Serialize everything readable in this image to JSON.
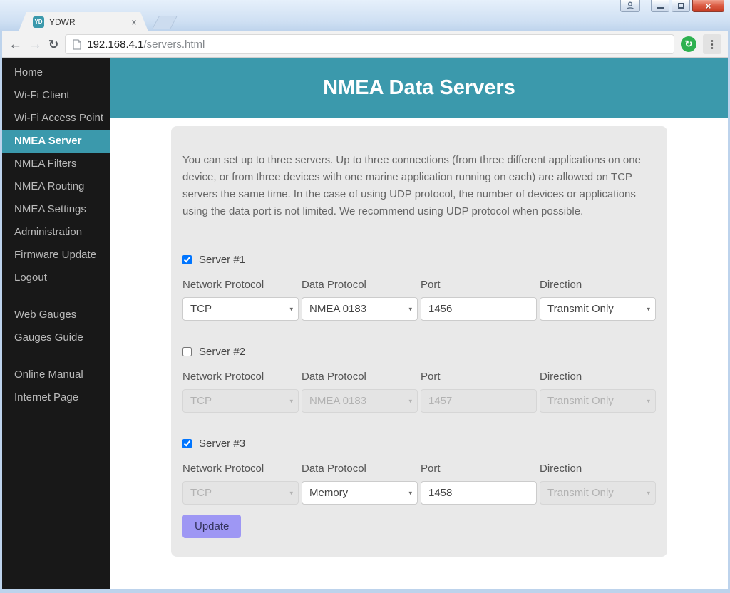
{
  "colors": {
    "teal": "#3b99ac",
    "sidebar_bg": "#181818",
    "accent_button": "#9e97f4",
    "green_badge": "#2eb150"
  },
  "icons": {
    "back": "←",
    "forward": "→",
    "reload": "↻",
    "menu": "⋮",
    "tab_close": "×",
    "window_close": "×",
    "select_arrow": "▾",
    "extension": "↻"
  },
  "browser": {
    "tab": {
      "favicon": "YD",
      "title": "YDWR"
    },
    "address": {
      "host": "192.168.4.1",
      "path": "/servers.html"
    }
  },
  "sidebar": {
    "groups": [
      {
        "items": [
          {
            "label": "Home"
          },
          {
            "label": "Wi-Fi Client"
          },
          {
            "label": "Wi-Fi Access Point"
          },
          {
            "label": "NMEA Server",
            "active": true
          },
          {
            "label": "NMEA Filters"
          },
          {
            "label": "NMEA Routing"
          },
          {
            "label": "NMEA Settings"
          },
          {
            "label": "Administration"
          },
          {
            "label": "Firmware Update"
          },
          {
            "label": "Logout"
          }
        ]
      },
      {
        "items": [
          {
            "label": "Web Gauges"
          },
          {
            "label": "Gauges Guide"
          }
        ]
      },
      {
        "items": [
          {
            "label": "Online Manual"
          },
          {
            "label": "Internet Page"
          }
        ]
      }
    ]
  },
  "main": {
    "title": "NMEA Data Servers",
    "intro": "You can set up to three servers. Up to three connections (from three different applications on one device, or from three devices with one marine application running on each) are allowed on TCP servers the same time. In the case of using UDP protocol, the number of devices or applications using the data port is not limited. We recommend using UDP protocol when possible.",
    "field_labels": [
      "Network Protocol",
      "Data Protocol",
      "Port",
      "Direction"
    ],
    "servers": [
      {
        "label": "Server #1",
        "enabled": true,
        "fields": [
          {
            "value": "TCP",
            "disabled": false
          },
          {
            "value": "NMEA 0183",
            "disabled": false
          },
          {
            "value": "1456",
            "disabled": false
          },
          {
            "value": "Transmit Only",
            "disabled": false
          }
        ]
      },
      {
        "label": "Server #2",
        "enabled": false,
        "fields": [
          {
            "value": "TCP",
            "disabled": true
          },
          {
            "value": "NMEA 0183",
            "disabled": true
          },
          {
            "value": "1457",
            "disabled": true
          },
          {
            "value": "Transmit Only",
            "disabled": true
          }
        ]
      },
      {
        "label": "Server #3",
        "enabled": true,
        "fields": [
          {
            "value": "TCP",
            "disabled": true
          },
          {
            "value": "Memory",
            "disabled": false
          },
          {
            "value": "1458",
            "disabled": false
          },
          {
            "value": "Transmit Only",
            "disabled": true
          }
        ]
      }
    ],
    "update_label": "Update"
  }
}
